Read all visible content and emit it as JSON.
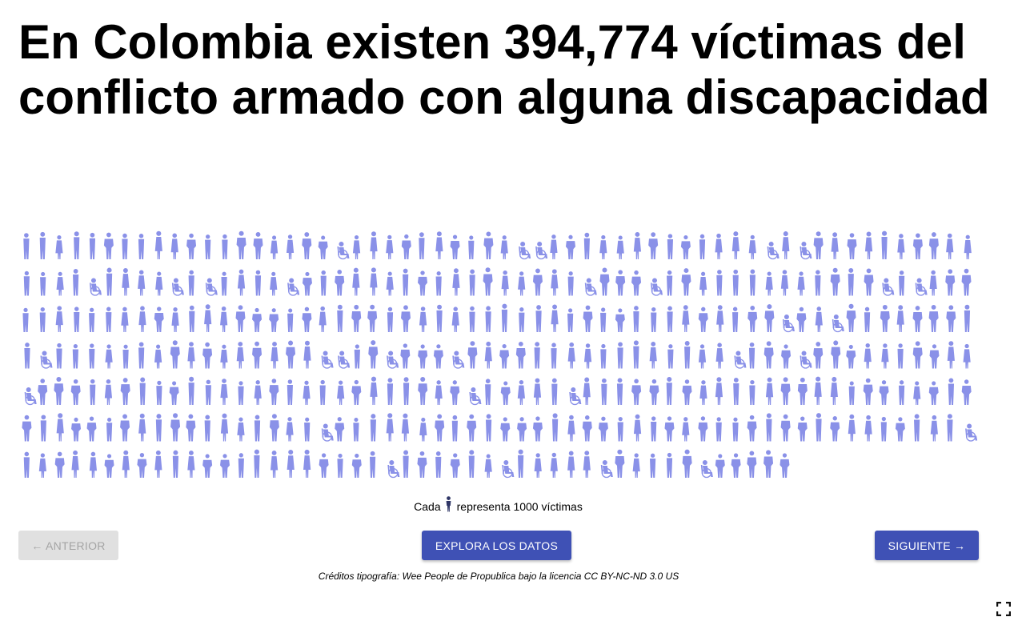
{
  "title": "En Colombia existen 394,774 víctimas del conflicto armado con alguna discapacidad",
  "chart_data": {
    "type": "pictogram",
    "total_victims": 394774,
    "units_per_icon": 1000,
    "icon_count": 395,
    "icons_per_row": 58,
    "icon_color": "#8a91e8",
    "wheelchair_icon_count": 31
  },
  "legend": {
    "prefix": "Cada",
    "suffix": "representa 1000 víctimas",
    "icon_color": "#2f3666"
  },
  "buttons": {
    "prev_label": "← ANTERIOR",
    "explore_label": "EXPLORA LOS DATOS",
    "next_label": "SIGUIENTE →"
  },
  "credits": "Créditos tipografía: Wee People de Propublica bajo la licencia CC BY-NC-ND 3.0 US",
  "colors": {
    "accent": "#3f51b5",
    "disabled_bg": "#e0e0e0",
    "disabled_text": "#a4a4a4"
  },
  "icons": {
    "fullscreen": "fullscreen-icon"
  }
}
